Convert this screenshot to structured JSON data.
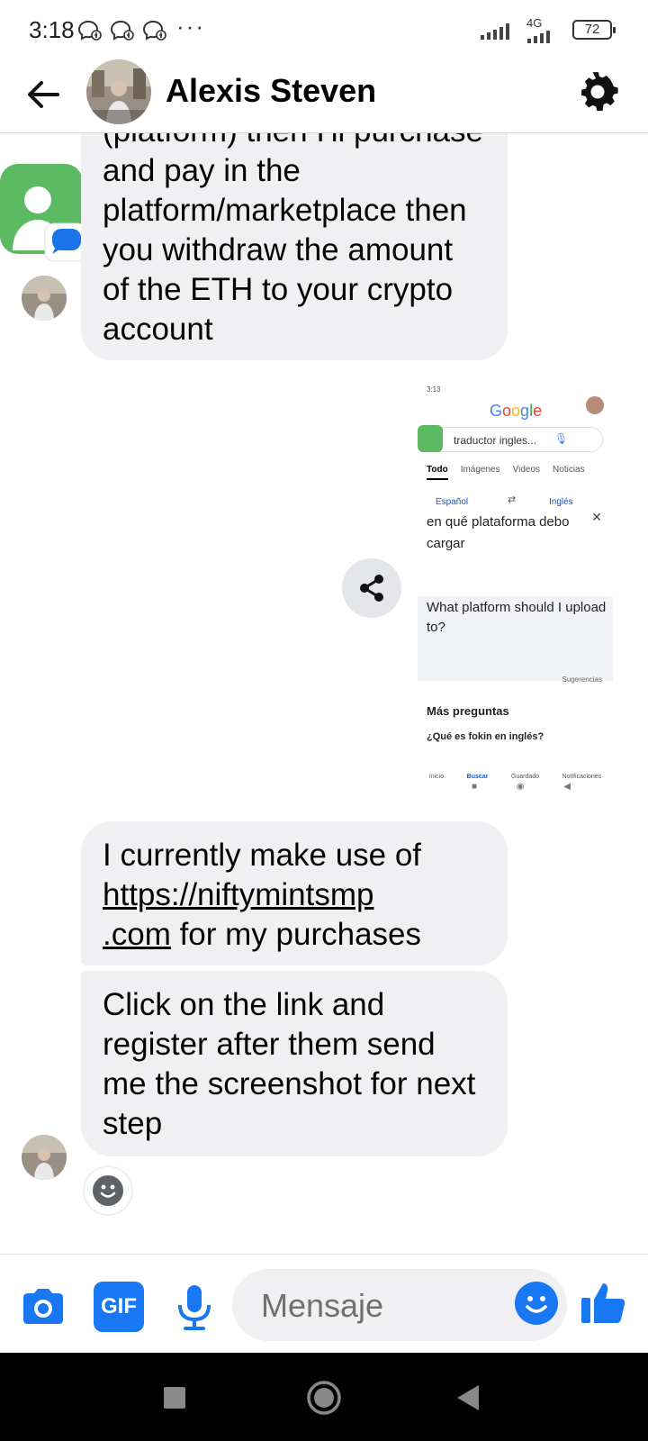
{
  "status_bar": {
    "time": "3:18",
    "notification_icons": [
      "messenger-icon",
      "messenger-icon",
      "messenger-icon"
    ],
    "more_indicator": "···",
    "network_label": "4G",
    "battery_level": "72"
  },
  "header": {
    "contact_name": "Alexis Steven"
  },
  "messages": [
    {
      "from": "contact",
      "text": "(platform) then I'll purchase and pay in the platform/marketplace then you withdraw the amount of the ETH to your crypto account"
    },
    {
      "from": "me",
      "type": "image",
      "screenshot": {
        "time": "3:13",
        "logo": "Google",
        "search_query": "traductor ingles...",
        "tabs": [
          "Todo",
          "Imágenes",
          "Videos",
          "Noticias"
        ],
        "source_lang": "Español",
        "target_lang": "Inglés",
        "source_text": "en qué plataforma debo cargar",
        "translated_text": "What platform should I upload to?",
        "suggestions_label": "Sugerencias",
        "more_questions": "Más preguntas",
        "question": "¿Qué es fokin en inglés?",
        "nav": [
          "Inicio",
          "Buscar",
          "Guardado",
          "Notificaciones"
        ]
      }
    },
    {
      "from": "contact",
      "text_before": "I currently make use of ",
      "link": "https://niftymintsmp.com",
      "link_line1": "https://niftymintsmp",
      "link_line2": ".com",
      "text_after": " for my purchases"
    },
    {
      "from": "contact",
      "text": "Click on the link and register after them send me the screenshot for next step"
    }
  ],
  "composer": {
    "placeholder": "Mensaje",
    "gif_label": "GIF"
  },
  "colors": {
    "accent": "#1877f2",
    "bubble": "#f0f0f2",
    "nav_bg": "#000000"
  }
}
